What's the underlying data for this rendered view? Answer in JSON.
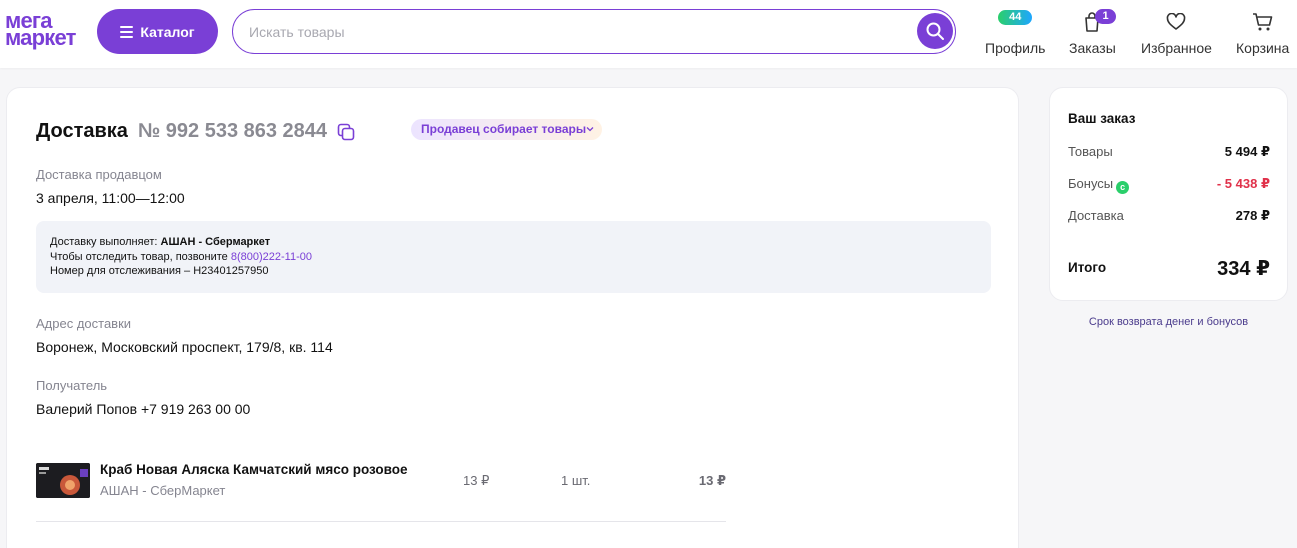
{
  "header": {
    "logo_line1": "мега",
    "logo_line2": "маркет",
    "catalog_label": "Каталог",
    "search_placeholder": "Искать товары",
    "nav": {
      "profile_label": "Профиль",
      "profile_bonus": "44",
      "orders_label": "Заказы",
      "orders_count": "1",
      "favorites_label": "Избранное",
      "cart_label": "Корзина"
    }
  },
  "order": {
    "title": "Доставка",
    "number": "№ 992 533 863 2844",
    "status": "Продавец собирает товары",
    "delivery_type_label": "Доставка продавцом",
    "delivery_time": "3 апреля, 11:00—12:00",
    "info": {
      "performer_prefix": "Доставку выполняет: ",
      "performer": "АШАН - Сбермаркет",
      "track_prefix": "Чтобы отследить товар, позвоните ",
      "phone": "8(800)222-11-00",
      "tracking": "Номер для отслеживания – H23401257950"
    },
    "address_label": "Адрес доставки",
    "address": "Воронеж, Московский проспект, 179/8, кв. 114",
    "recipient_label": "Получатель",
    "recipient": "Валерий Попов +7 919 263 00 00",
    "items": [
      {
        "name": "Краб Новая Аляска Камчатский мясо розовое",
        "seller": "АШАН - СберМаркет",
        "price": "13 ₽",
        "qty": "1 шт.",
        "total": "13 ₽"
      }
    ]
  },
  "summary": {
    "title": "Ваш заказ",
    "goods_label": "Товары",
    "goods_value": "5 494 ₽",
    "bonus_label": "Бонусы",
    "bonus_value": "- 5 438 ₽",
    "delivery_label": "Доставка",
    "delivery_value": "278 ₽",
    "total_label": "Итого",
    "total_value": "334 ₽",
    "refund_link": "Срок возврата денег и бонусов"
  },
  "colors": {
    "brand": "#7a3fd6",
    "discount": "#e0314a",
    "bonus": "#2bcf6b"
  }
}
